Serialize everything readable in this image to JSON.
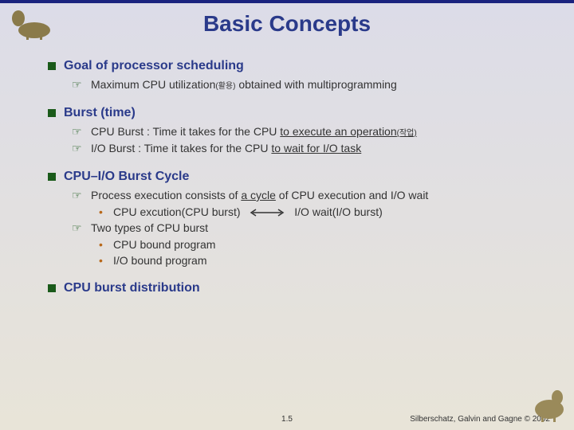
{
  "title": "Basic Concepts",
  "sections": [
    {
      "heading": "Goal of processor scheduling",
      "subs": [
        {
          "pre": "Maximum CPU utilization",
          "small": "(활용)",
          "post": " obtained with multiprogramming"
        }
      ]
    },
    {
      "heading": "Burst (time)",
      "subs": [
        {
          "pre": "CPU Burst : Time it takes for the CPU ",
          "u": "to execute an operation",
          "small_u": "(작업)"
        },
        {
          "pre": "I/O Burst : Time it takes for the CPU ",
          "u": "to wait for I/O task"
        }
      ]
    },
    {
      "heading": "CPU–I/O Burst Cycle",
      "subs": [
        {
          "pre": "Process execution consists of ",
          "u": "a cycle",
          "post": " of CPU execution and I/O wait",
          "children": [
            {
              "text": "CPU excution(CPU burst)",
              "arrow": true,
              "text2": "I/O wait(I/O burst)"
            }
          ]
        },
        {
          "pre": "Two types of CPU burst",
          "children": [
            {
              "text": "CPU bound program"
            },
            {
              "text": "I/O bound program"
            }
          ]
        }
      ]
    },
    {
      "heading": "CPU burst distribution",
      "subs": []
    }
  ],
  "footer": {
    "page": "1.5",
    "credit": "Silberschatz, Galvin and Gagne © 2002"
  }
}
